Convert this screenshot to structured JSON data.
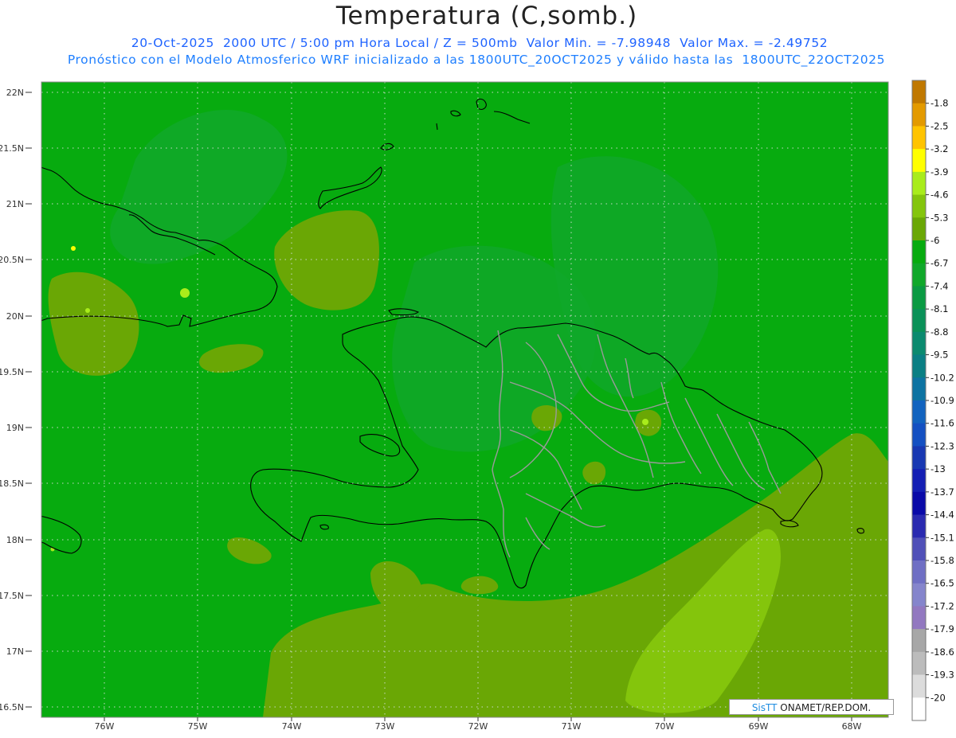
{
  "header": {
    "title": "Temperatura (C,somb.)",
    "line1": "20-Oct-2025  2000 UTC / 5:00 pm Hora Local / Z = 500mb  Valor Min. = -7.98948  Valor Max. = -2.49752",
    "line2": "Pronóstico con el Modelo Atmosferico WRF inicializado a las 1800UTC_20OCT2025 y válido hasta las  1800UTC_22OCT2025"
  },
  "map": {
    "lat_labels": [
      "22N",
      "21.5N",
      "21N",
      "20.5N",
      "20N",
      "19.5N",
      "19N",
      "18.5N",
      "18N",
      "17.5N",
      "17N",
      "16.5N"
    ],
    "lon_labels": [
      "76W",
      "75W",
      "74W",
      "73W",
      "72W",
      "71W",
      "70W",
      "69W",
      "68W"
    ],
    "background_color": "#07ab0f",
    "grid": true
  },
  "colorbar": {
    "labels": [
      "-1.8",
      "-2.5",
      "-3.2",
      "-3.9",
      "-4.6",
      "-5.3",
      "-6",
      "-6.7",
      "-7.4",
      "-8.1",
      "-8.8",
      "-9.5",
      "-10.2",
      "-10.9",
      "-11.6",
      "-12.3",
      "-13",
      "-13.7",
      "-14.4",
      "-15.1",
      "-15.8",
      "-16.5",
      "-17.2",
      "-17.9",
      "-18.6",
      "-19.3",
      "-20"
    ],
    "colors": [
      "#c07800",
      "#e39a00",
      "#ffc400",
      "#ffff00",
      "#a9ec1b",
      "#84c50c",
      "#6aa705",
      "#07ab0f",
      "#10a82a",
      "#0a9a42",
      "#0a9158",
      "#0b8a6f",
      "#0a7f84",
      "#0d73a2",
      "#1263bf",
      "#1450c2",
      "#1838b2",
      "#141fb4",
      "#0a0aa8",
      "#2a2ab0",
      "#5050b8",
      "#6f6fc4",
      "#8585cc",
      "#9278c0",
      "#a7a7a7",
      "#bcbcbc",
      "#dcdcdc",
      "#ffffff"
    ]
  },
  "credit": {
    "brand": "SisTT",
    "text": " ONAMET/REP.DOM."
  }
}
